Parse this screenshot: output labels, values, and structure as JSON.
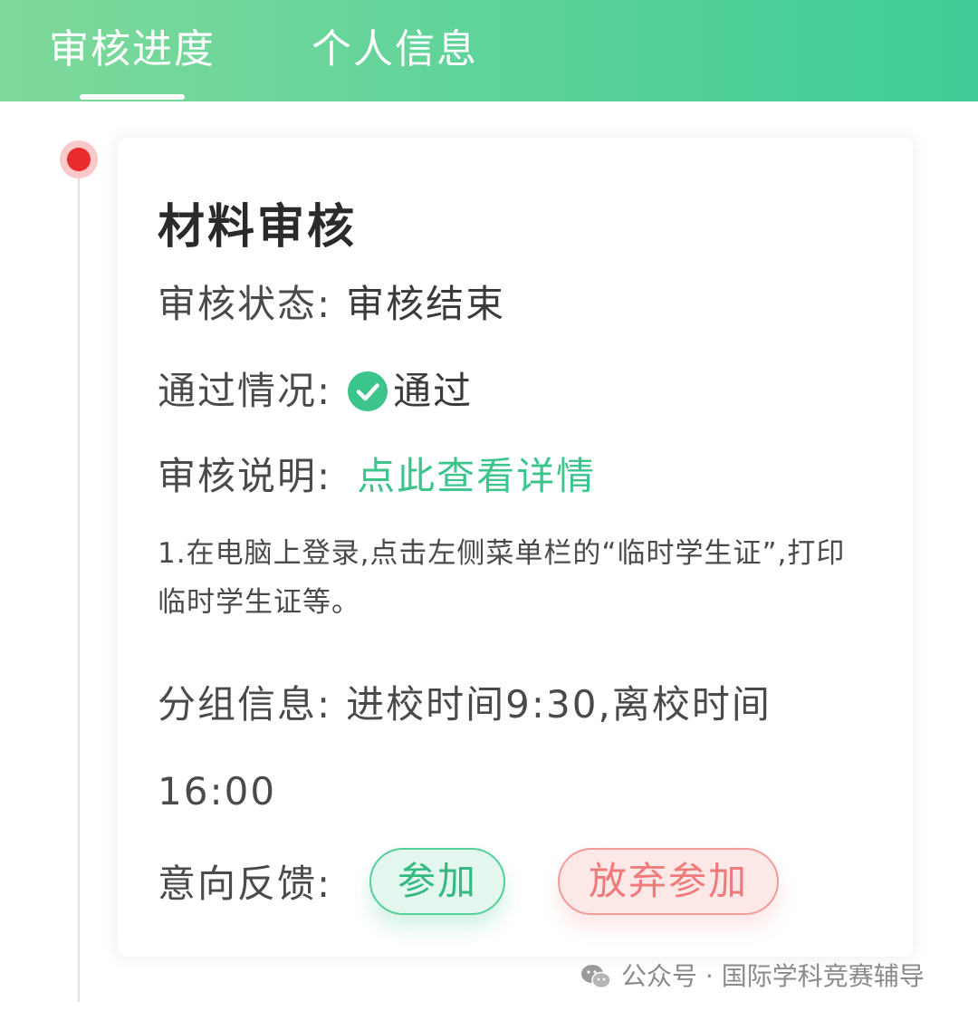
{
  "tabs": [
    {
      "label": "审核进度",
      "active": true
    },
    {
      "label": "个人信息",
      "active": false
    }
  ],
  "card": {
    "title": "材料审核",
    "status_label": "审核状态:",
    "status_value": "审核结束",
    "pass_label": "通过情况:",
    "pass_value": "通过",
    "desc_label": "审核说明:",
    "desc_link": "点此查看详情",
    "note": "1.在电脑上登录,点击左侧菜单栏的“临时学生证”,打印临时学生证等。",
    "group_label": "分组信息:",
    "group_value": "进校时间9:30,离校时间16:00",
    "feedback_label": "意向反馈:",
    "join_label": "参加",
    "quit_label": "放弃参加"
  },
  "watermark": {
    "text": "公众号 · 国际学科竞赛辅导",
    "icon": "wechat-icon"
  },
  "colors": {
    "header_gradient_start": "#7fd99a",
    "header_gradient_end": "#3fcc96",
    "accent_green": "#3cc48d",
    "timeline_dot": "#ea2b2b",
    "quit_red": "#f07a7a"
  }
}
